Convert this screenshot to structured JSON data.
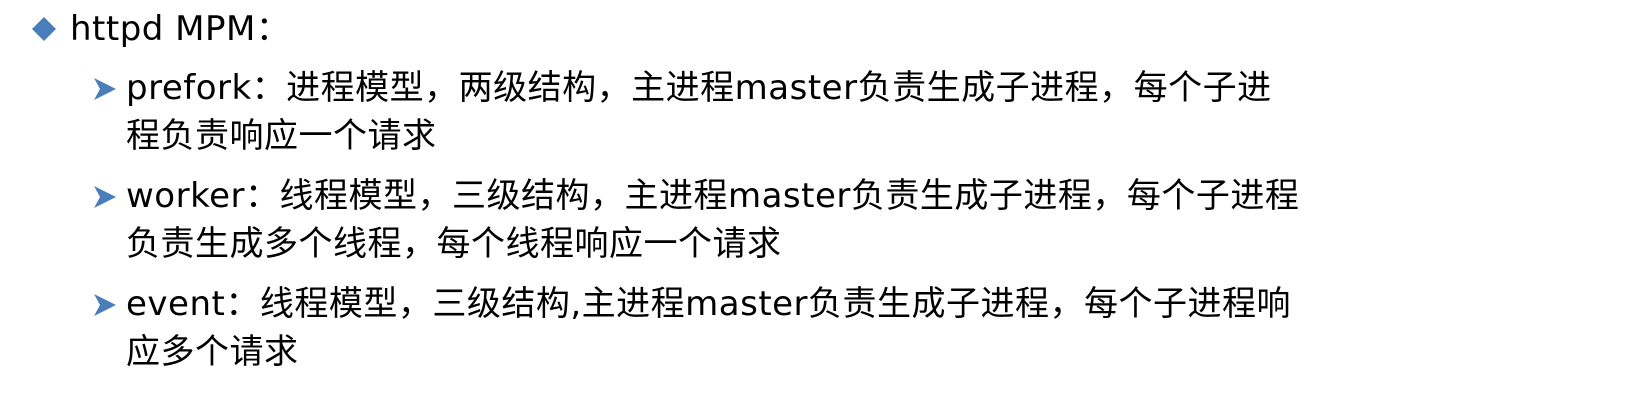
{
  "heading": {
    "text": "httpd MPM："
  },
  "items": [
    {
      "lines": [
        "prefork：进程模型，两级结构，主进程master负责生成子进程，每个子进",
        "程负责响应一个请求"
      ]
    },
    {
      "lines": [
        "worker：线程模型，三级结构，主进程master负责生成子进程，每个子进程",
        "负责生成多个线程，每个线程响应一个请求"
      ]
    },
    {
      "lines": [
        "event：线程模型，三级结构,主进程master负责生成子进程，每个子进程响",
        "应多个请求"
      ]
    }
  ],
  "colors": {
    "diamond": "#4a7ebb",
    "arrow": "#4a7ebb",
    "text": "#000000"
  }
}
